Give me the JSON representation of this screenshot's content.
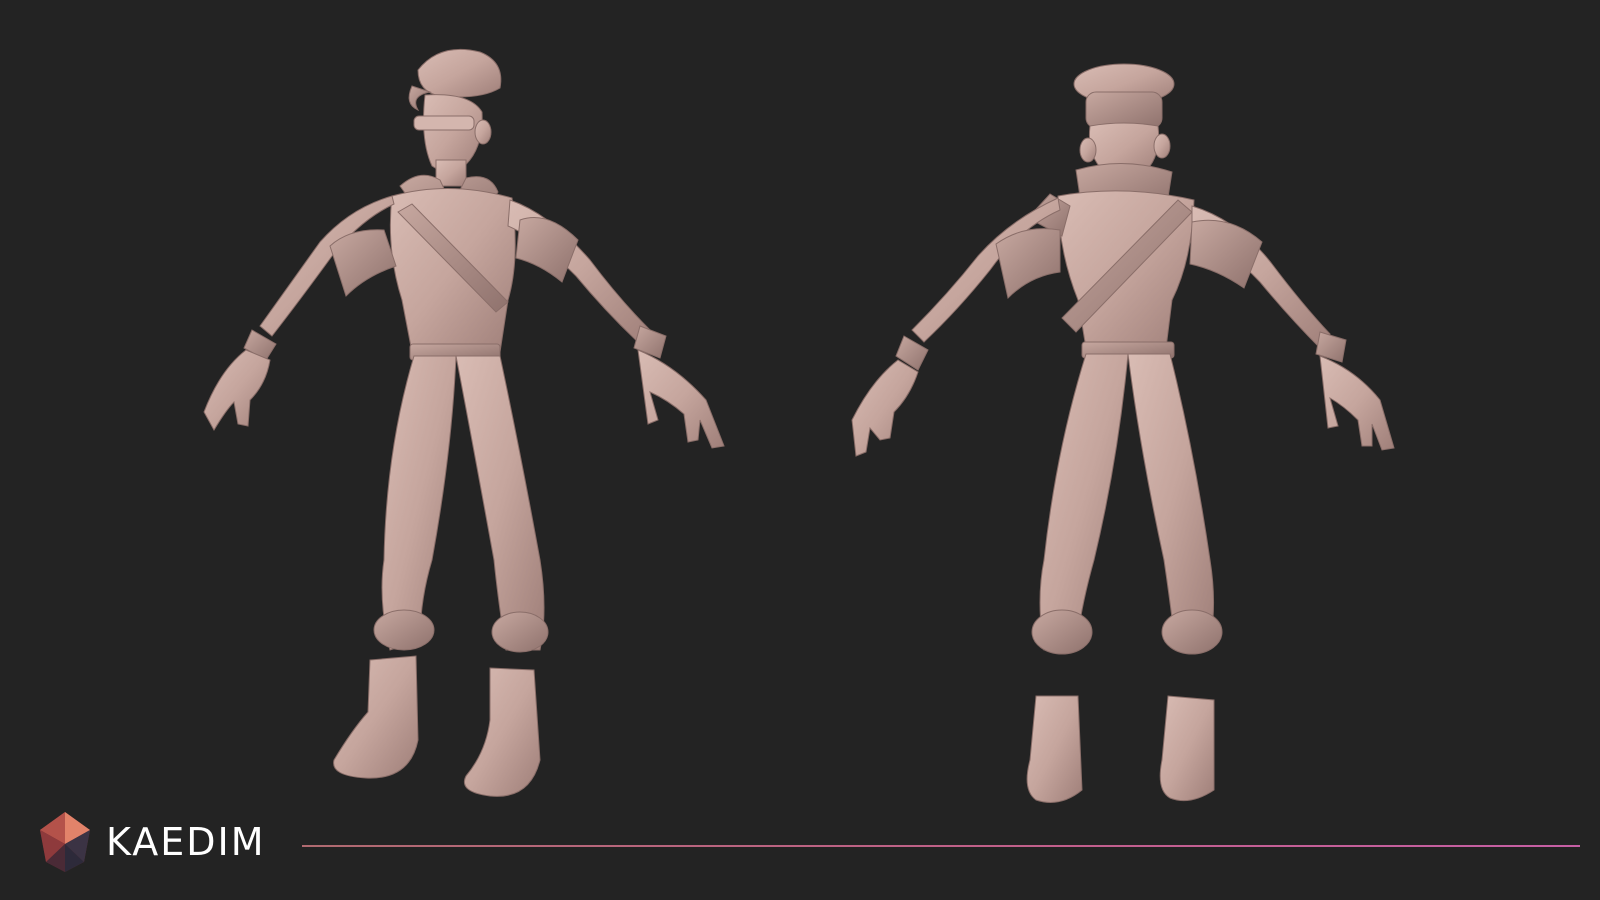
{
  "brand": {
    "name": "KAEDIM",
    "logo_icon": "kaedim-gem-icon",
    "accent_color": "#c46290"
  },
  "scene": {
    "background_color": "#232323",
    "model_color": "#c8a9a2",
    "views": [
      {
        "name": "front-view",
        "icon": "character-model-front"
      },
      {
        "name": "back-view",
        "icon": "character-model-back"
      }
    ]
  }
}
